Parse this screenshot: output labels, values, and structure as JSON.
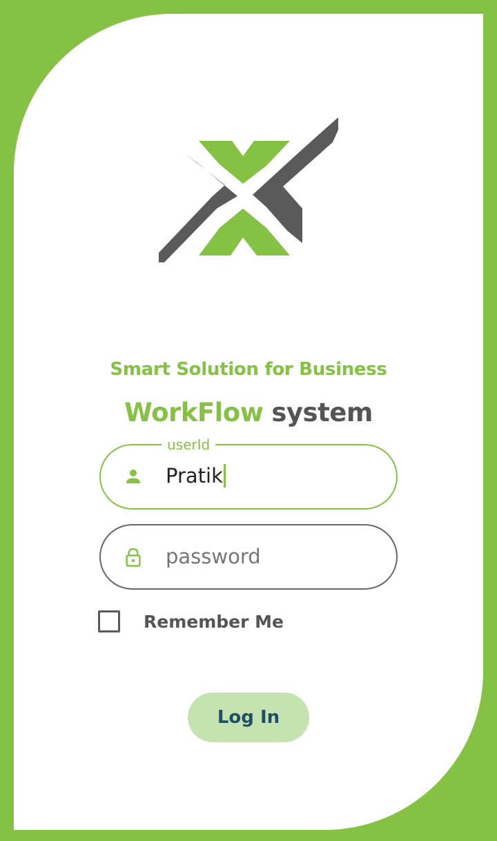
{
  "colors": {
    "accent": "#85c142",
    "dark": "#555555",
    "button_bg": "#c5e3b0",
    "button_text": "#1f4f66"
  },
  "logo": {
    "icon": "x-logo-icon"
  },
  "tagline": "Smart Solution for Business",
  "brand": {
    "word1": "WorkFlow",
    "word2": "system"
  },
  "userid_field": {
    "label": "userId",
    "value": "Pratik",
    "icon": "person-icon"
  },
  "password_field": {
    "placeholder": "password",
    "icon": "lock-icon"
  },
  "remember_me": {
    "label": "Remember Me",
    "checked": false
  },
  "login_button": {
    "label": "Log In"
  }
}
